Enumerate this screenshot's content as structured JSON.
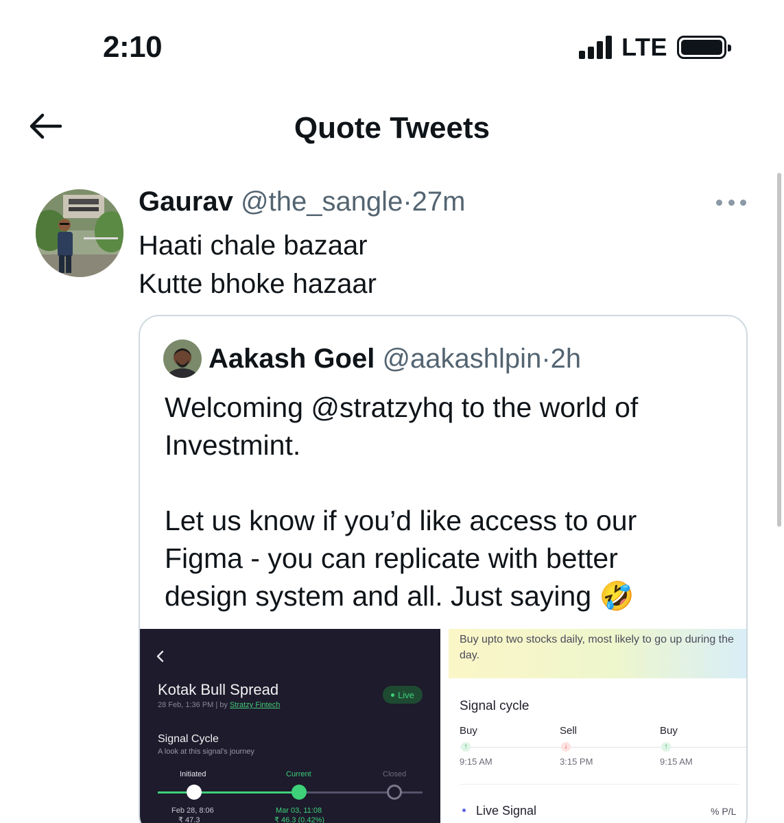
{
  "status_bar": {
    "time": "2:10",
    "network": "LTE",
    "signal_bars": 4,
    "battery_level": 1.0
  },
  "header": {
    "back_icon": "arrow-left-icon",
    "title": "Quote Tweets"
  },
  "tweet": {
    "name": "Gaurav",
    "handle": "@the_sangle",
    "separator": "·",
    "time": "27m",
    "more_icon": "more-horizontal-icon",
    "lines": [
      "Haati chale bazaar",
      "Kutte bhoke hazaar"
    ]
  },
  "quoted_tweet": {
    "name": "Aakash Goel",
    "handle": "@aakashlpin",
    "separator": "·",
    "time": "2h",
    "paragraph1_lines": [
      "Welcoming @stratzyhq to the world of",
      "Investmint."
    ],
    "paragraph2_lines": [
      "Let us know if you’d like access to our",
      "Figma - you can replicate with better",
      "design system and all. Just saying 🤣"
    ],
    "media_left": {
      "title": "Kotak Bull Spread",
      "subtitle_prefix": "28 Feb, 1:36 PM | by ",
      "subtitle_link": "Stratzy Fintech",
      "live_badge": "Live",
      "signal_cycle_title": "Signal Cycle",
      "signal_cycle_subtitle": "A look at this signal's journey",
      "steps": [
        {
          "label": "Initiated",
          "date": "Feb 28, 8:06",
          "value": "₹ 47.3"
        },
        {
          "label": "Current",
          "date": "Mar 03, 11:08",
          "value": "₹ 46.3 (0.42%)"
        },
        {
          "label": "Closed"
        }
      ],
      "colors": {
        "background": "#1d1b2c",
        "accent": "#3ed17a"
      }
    },
    "media_right": {
      "banner_text": "Buy upto two stocks daily, most likely to go up during the day.",
      "signal_cycle_title": "Signal cycle",
      "columns": [
        {
          "label": "Buy",
          "direction": "up",
          "time": "9:15 AM"
        },
        {
          "label": "Sell",
          "direction": "down",
          "time": "3:15 PM"
        },
        {
          "label": "Buy",
          "direction": "up",
          "time": "9:15 AM"
        }
      ],
      "live_signal": "Live Signal",
      "pl_label": "% P/L"
    }
  }
}
